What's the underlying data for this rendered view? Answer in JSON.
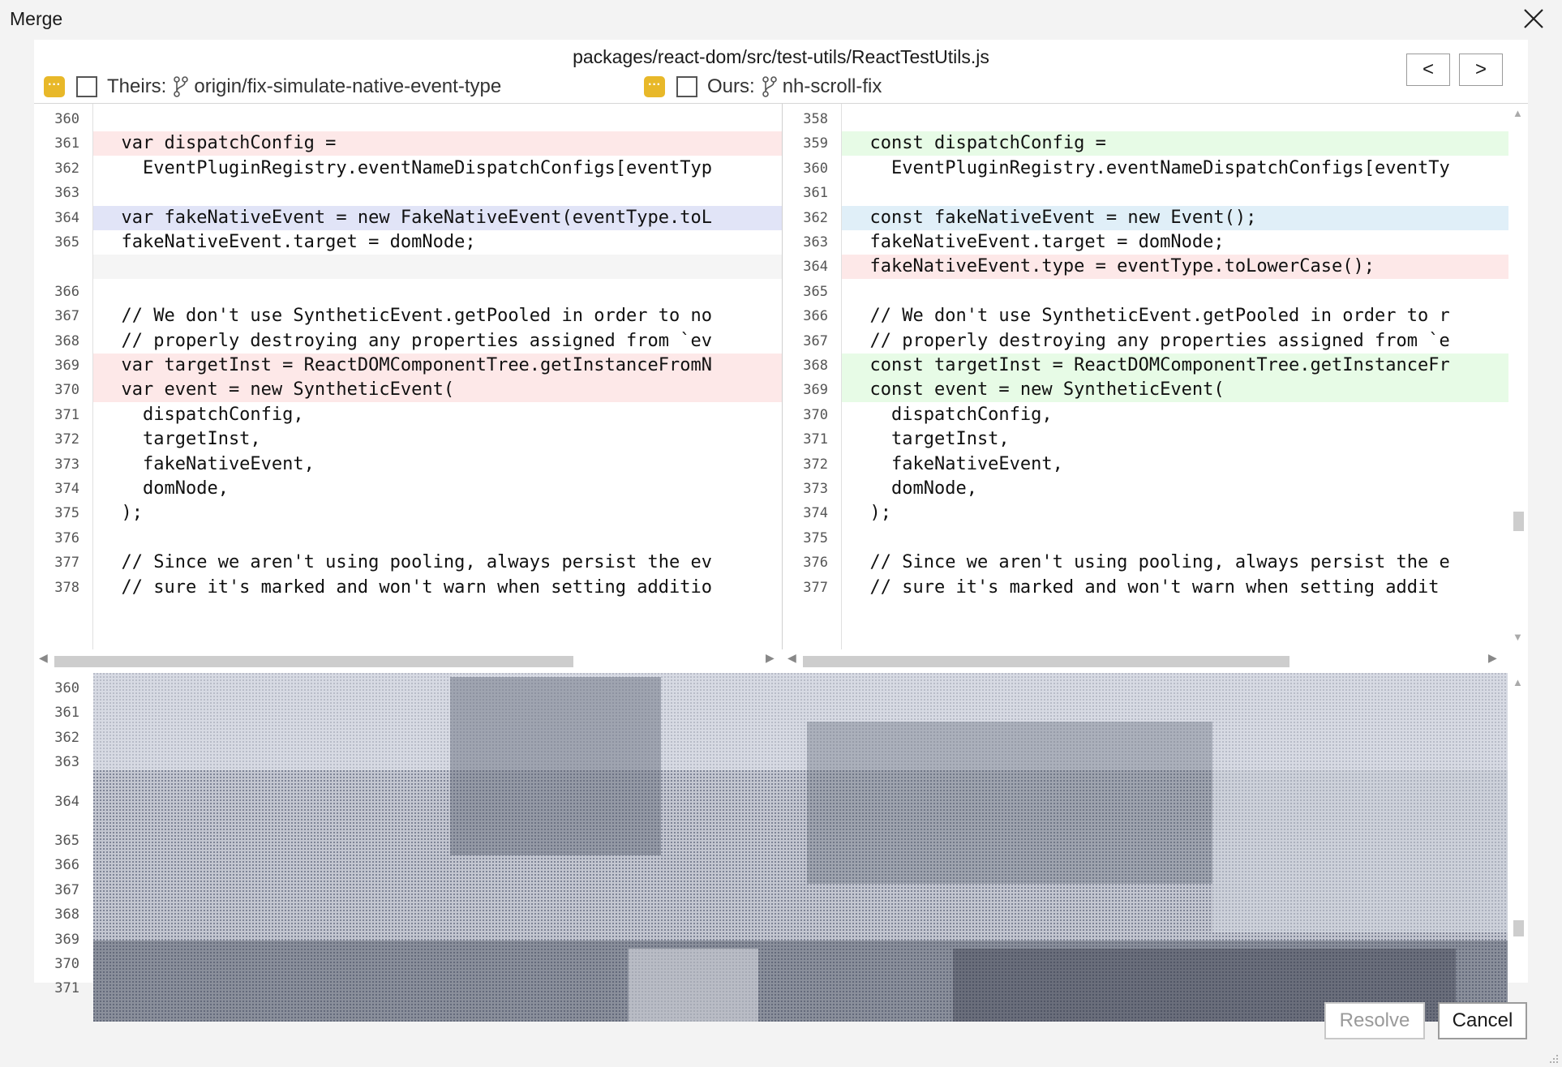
{
  "window": {
    "title": "Merge"
  },
  "file": {
    "path": "packages/react-dom/src/test-utils/ReactTestUtils.js"
  },
  "nav": {
    "prev": "<",
    "next": ">"
  },
  "theirs": {
    "label": "Theirs:",
    "branch": "origin/fix-simulate-native-event-type"
  },
  "ours": {
    "label": "Ours:",
    "branch": "nh-scroll-fix"
  },
  "colors": {
    "conflict": "#e8b829",
    "removed": "#fde8e8",
    "added": "#e7fbe6",
    "changed_left": "#e1e4f7",
    "changed_right": "#e0eff8"
  },
  "theirs_lines": [
    {
      "n": "360",
      "t": "",
      "c": ""
    },
    {
      "n": "361",
      "t": "  var dispatchConfig =",
      "c": "red"
    },
    {
      "n": "362",
      "t": "    EventPluginRegistry.eventNameDispatchConfigs[eventTyp",
      "c": ""
    },
    {
      "n": "363",
      "t": "",
      "c": ""
    },
    {
      "n": "364",
      "t": "  var fakeNativeEvent = new FakeNativeEvent(eventType.toL",
      "c": "blue"
    },
    {
      "n": "365",
      "t": "  fakeNativeEvent.target = domNode;",
      "c": ""
    },
    {
      "n": "",
      "t": "",
      "c": "gray"
    },
    {
      "n": "366",
      "t": "",
      "c": ""
    },
    {
      "n": "367",
      "t": "  // We don't use SyntheticEvent.getPooled in order to no",
      "c": ""
    },
    {
      "n": "368",
      "t": "  // properly destroying any properties assigned from `ev",
      "c": ""
    },
    {
      "n": "369",
      "t": "  var targetInst = ReactDOMComponentTree.getInstanceFromN",
      "c": "red"
    },
    {
      "n": "370",
      "t": "  var event = new SyntheticEvent(",
      "c": "red"
    },
    {
      "n": "371",
      "t": "    dispatchConfig,",
      "c": ""
    },
    {
      "n": "372",
      "t": "    targetInst,",
      "c": ""
    },
    {
      "n": "373",
      "t": "    fakeNativeEvent,",
      "c": ""
    },
    {
      "n": "374",
      "t": "    domNode,",
      "c": ""
    },
    {
      "n": "375",
      "t": "  );",
      "c": ""
    },
    {
      "n": "376",
      "t": "",
      "c": ""
    },
    {
      "n": "377",
      "t": "  // Since we aren't using pooling, always persist the ev",
      "c": ""
    },
    {
      "n": "378",
      "t": "  // sure it's marked and won't warn when setting additio",
      "c": ""
    }
  ],
  "ours_lines": [
    {
      "n": "358",
      "t": "",
      "c": ""
    },
    {
      "n": "359",
      "t": "  const dispatchConfig =",
      "c": "green"
    },
    {
      "n": "360",
      "t": "    EventPluginRegistry.eventNameDispatchConfigs[eventTy",
      "c": ""
    },
    {
      "n": "361",
      "t": "",
      "c": ""
    },
    {
      "n": "362",
      "t": "  const fakeNativeEvent = new Event();",
      "c": "cyan"
    },
    {
      "n": "363",
      "t": "  fakeNativeEvent.target = domNode;",
      "c": ""
    },
    {
      "n": "364",
      "t": "  fakeNativeEvent.type = eventType.toLowerCase();",
      "c": "red"
    },
    {
      "n": "365",
      "t": "",
      "c": ""
    },
    {
      "n": "366",
      "t": "  // We don't use SyntheticEvent.getPooled in order to r",
      "c": ""
    },
    {
      "n": "367",
      "t": "  // properly destroying any properties assigned from `e",
      "c": ""
    },
    {
      "n": "368",
      "t": "  const targetInst = ReactDOMComponentTree.getInstanceFr",
      "c": "green"
    },
    {
      "n": "369",
      "t": "  const event = new SyntheticEvent(",
      "c": "green"
    },
    {
      "n": "370",
      "t": "    dispatchConfig,",
      "c": ""
    },
    {
      "n": "371",
      "t": "    targetInst,",
      "c": ""
    },
    {
      "n": "372",
      "t": "    fakeNativeEvent,",
      "c": ""
    },
    {
      "n": "373",
      "t": "    domNode,",
      "c": ""
    },
    {
      "n": "374",
      "t": "  );",
      "c": ""
    },
    {
      "n": "375",
      "t": "",
      "c": ""
    },
    {
      "n": "376",
      "t": "  // Since we aren't using pooling, always persist the e",
      "c": ""
    },
    {
      "n": "377",
      "t": "  // sure it's marked and won't warn when setting addit",
      "c": ""
    }
  ],
  "result_lines": [
    {
      "n": "360",
      "gap": false
    },
    {
      "n": "361",
      "gap": false
    },
    {
      "n": "362",
      "gap": false
    },
    {
      "n": "363",
      "gap": false
    },
    {
      "n": "",
      "gap": true
    },
    {
      "n": "364",
      "gap": false
    },
    {
      "n": "",
      "gap": true
    },
    {
      "n": "365",
      "gap": false
    },
    {
      "n": "366",
      "gap": false
    },
    {
      "n": "367",
      "gap": false
    },
    {
      "n": "368",
      "gap": false
    },
    {
      "n": "369",
      "gap": false
    },
    {
      "n": "370",
      "gap": false
    },
    {
      "n": "371",
      "gap": false
    }
  ],
  "buttons": {
    "resolve": "Resolve",
    "cancel": "Cancel"
  }
}
